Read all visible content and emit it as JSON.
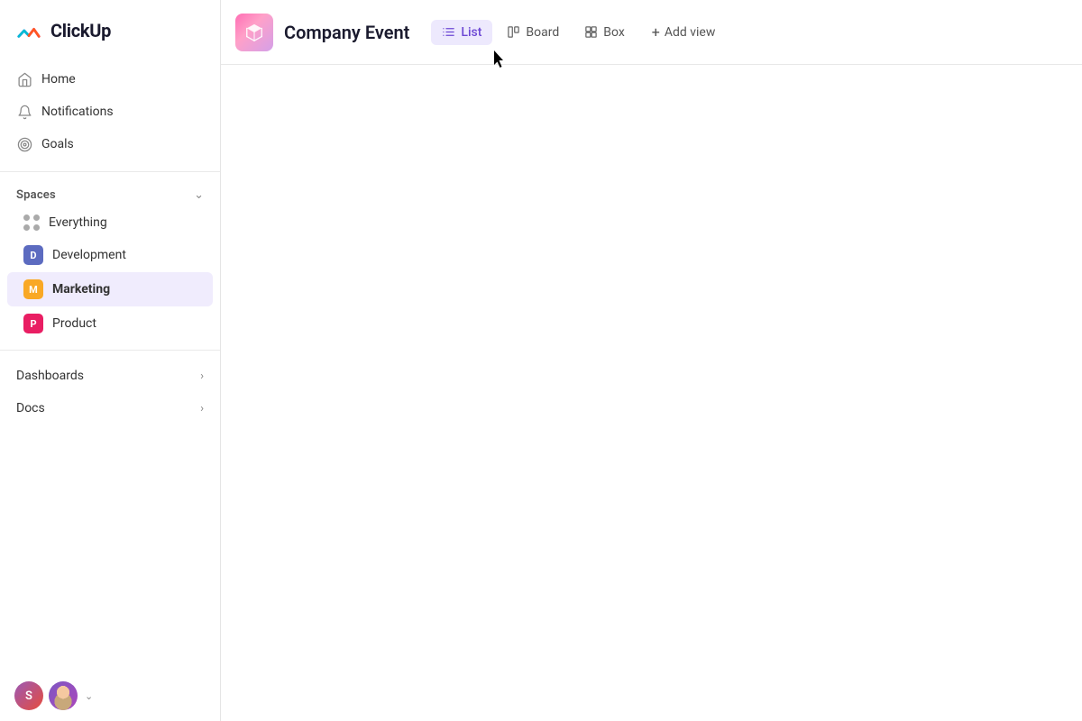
{
  "app": {
    "name": "ClickUp"
  },
  "sidebar": {
    "logo_text": "ClickUp",
    "nav_items": [
      {
        "id": "home",
        "label": "Home",
        "icon": "home"
      },
      {
        "id": "notifications",
        "label": "Notifications",
        "icon": "bell"
      },
      {
        "id": "goals",
        "label": "Goals",
        "icon": "target"
      }
    ],
    "spaces_label": "Spaces",
    "spaces": [
      {
        "id": "everything",
        "label": "Everything",
        "type": "dots"
      },
      {
        "id": "development",
        "label": "Development",
        "type": "avatar",
        "color": "#5c6bc0",
        "initials": "D"
      },
      {
        "id": "marketing",
        "label": "Marketing",
        "type": "avatar",
        "color": "#f9a825",
        "initials": "M",
        "bold": true
      },
      {
        "id": "product",
        "label": "Product",
        "type": "avatar",
        "color": "#e91e63",
        "initials": "P"
      }
    ],
    "expandable": [
      {
        "id": "dashboards",
        "label": "Dashboards"
      },
      {
        "id": "docs",
        "label": "Docs"
      }
    ]
  },
  "header": {
    "project_title": "Company Event",
    "tabs": [
      {
        "id": "list",
        "label": "List",
        "active": true
      },
      {
        "id": "board",
        "label": "Board",
        "active": false
      },
      {
        "id": "box",
        "label": "Box",
        "active": false
      }
    ],
    "add_view_label": "Add view"
  }
}
